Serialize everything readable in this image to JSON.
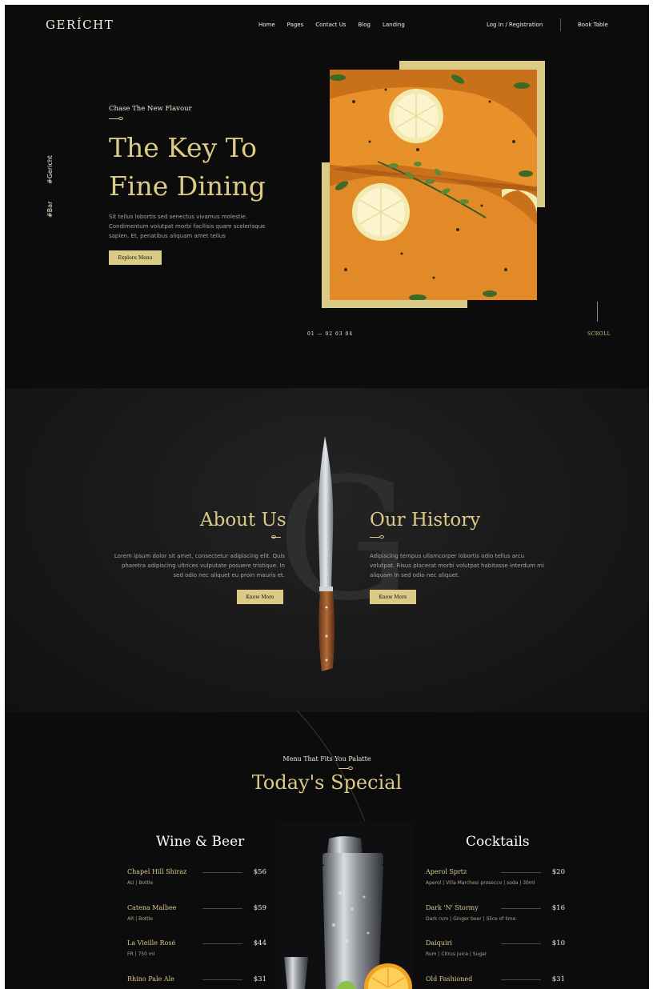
{
  "nav": {
    "logo": "GERÍCHT",
    "links": [
      "Home",
      "Pages",
      "Contact Us",
      "Blog",
      "Landing"
    ],
    "login": "Log In / Registration",
    "book": "Book Table"
  },
  "hero": {
    "side_top": "#Gericht",
    "side_bottom": "#Bar",
    "subtitle": "Chase The New Flavour",
    "title_line1": "The Key To",
    "title_line2": "Fine Dining",
    "description": "Sit tellus lobortis sed senectus vivamus molestie. Condimentum volutpat morbi facilisis quam scelerisque sapien. Et, penatibus aliquam amet tellus",
    "button": "Explore Menu",
    "slides": "01 — 02 03 04",
    "scroll": "SCROLL"
  },
  "about": {
    "big_letter": "G",
    "about_title": "About Us",
    "about_text": "Lorem ipsum dolor sit amet, consectetur adipiscing elit. Quis pharetra adipiscing ultrices vulputate posuere tristique. In sed odio nec aliquet eu proin mauris et.",
    "about_button": "Know More",
    "history_title": "Our History",
    "history_text": "Adipiscing tempus ullamcorper lobortis odio tellus arcu volutpat. Risus placerat morbi volutpat habitasse interdum mi aliquam In sed odio nec aliquet.",
    "history_button": "Know More"
  },
  "menu": {
    "subtitle": "Menu That Fits You Palatte",
    "title": "Today's Special",
    "wine_title": "Wine & Beer",
    "cocktail_title": "Cocktails",
    "wine": [
      {
        "name": "Chapel Hill Shiraz",
        "price": "$56",
        "desc": "AU | Bottle"
      },
      {
        "name": "Catena Malbee",
        "price": "$59",
        "desc": "AR | Bottle"
      },
      {
        "name": "La Vieille Rosé",
        "price": "$44",
        "desc": "FR | 750 ml"
      },
      {
        "name": "Rhino Pale Ale",
        "price": "$31",
        "desc": ""
      }
    ],
    "cocktails": [
      {
        "name": "Aperol Sprtz",
        "price": "$20",
        "desc": "Aperol | Villa Marchesi prosecco | soda | 30ml"
      },
      {
        "name": "Dark 'N' Stormy",
        "price": "$16",
        "desc": "Dark rum | Ginger beer | Slice of lime."
      },
      {
        "name": "Daiquiri",
        "price": "$10",
        "desc": "Rum | Citrus juice | Sugar"
      },
      {
        "name": "Old Fashioned",
        "price": "$31",
        "desc": ""
      }
    ]
  },
  "colors": {
    "accent": "#dcca87",
    "background": "#0c0c0c",
    "text": "#f5efdb",
    "muted": "#a9a59a"
  }
}
